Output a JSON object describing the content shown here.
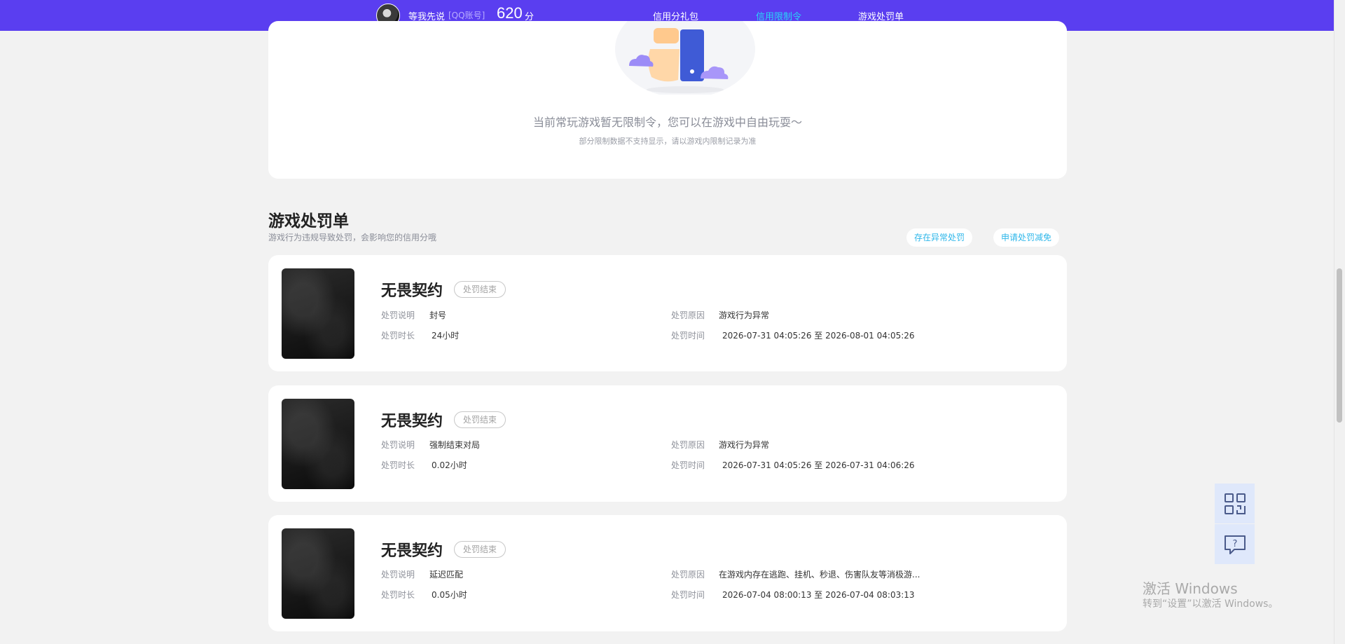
{
  "topbar": {
    "username": "等我先说",
    "account_tag": "[QQ账号]",
    "score": "620",
    "score_unit": "分",
    "nav": [
      {
        "label": "信用分礼包",
        "active": false
      },
      {
        "label": "信用限制令",
        "active": true
      },
      {
        "label": "游戏处罚单",
        "active": false
      }
    ],
    "active_color": "#28d6f7",
    "bar_color": "#5a3ef0"
  },
  "empty_state": {
    "message": "当前常玩游戏暂无限制令，您可以在游戏中自由玩耍～",
    "note": "部分限制数据不支持显示，请以游戏内限制记录为准"
  },
  "penalty_section": {
    "title": "游戏处罚单",
    "description": "游戏行为违规导致处罚，会影响您的信用分哦",
    "buttons": {
      "abnormal": "存在异常处罚",
      "appeal": "申请处罚减免"
    },
    "labels": {
      "desc": "处罚说明",
      "duration": "处罚时长",
      "reason": "处罚原因",
      "time": "处罚时间"
    },
    "items": [
      {
        "game": "无畏契约",
        "status": "处罚结束",
        "desc": "封号",
        "duration": "24小时",
        "reason": "游戏行为异常",
        "time": "2026-07-31 04:05:26 至 2026-08-01 04:05:26"
      },
      {
        "game": "无畏契约",
        "status": "处罚结束",
        "desc": "强制结束对局",
        "duration": "0.02小时",
        "reason": "游戏行为异常",
        "time": "2026-07-31 04:05:26 至 2026-07-31 04:06:26"
      },
      {
        "game": "无畏契约",
        "status": "处罚结束",
        "desc": "延迟匹配",
        "duration": "0.05小时",
        "reason": "在游戏内存在逃跑、挂机、秒退、伤害队友等消极游...",
        "time": "2026-07-04 08:00:13 至 2026-07-04 08:03:13"
      }
    ]
  },
  "side_tools": {
    "qr_icon": "qr-code-icon",
    "help_icon": "help-chat-icon"
  },
  "watermark": {
    "line1": "激活 Windows",
    "line2": "转到“设置”以激活 Windows。"
  }
}
